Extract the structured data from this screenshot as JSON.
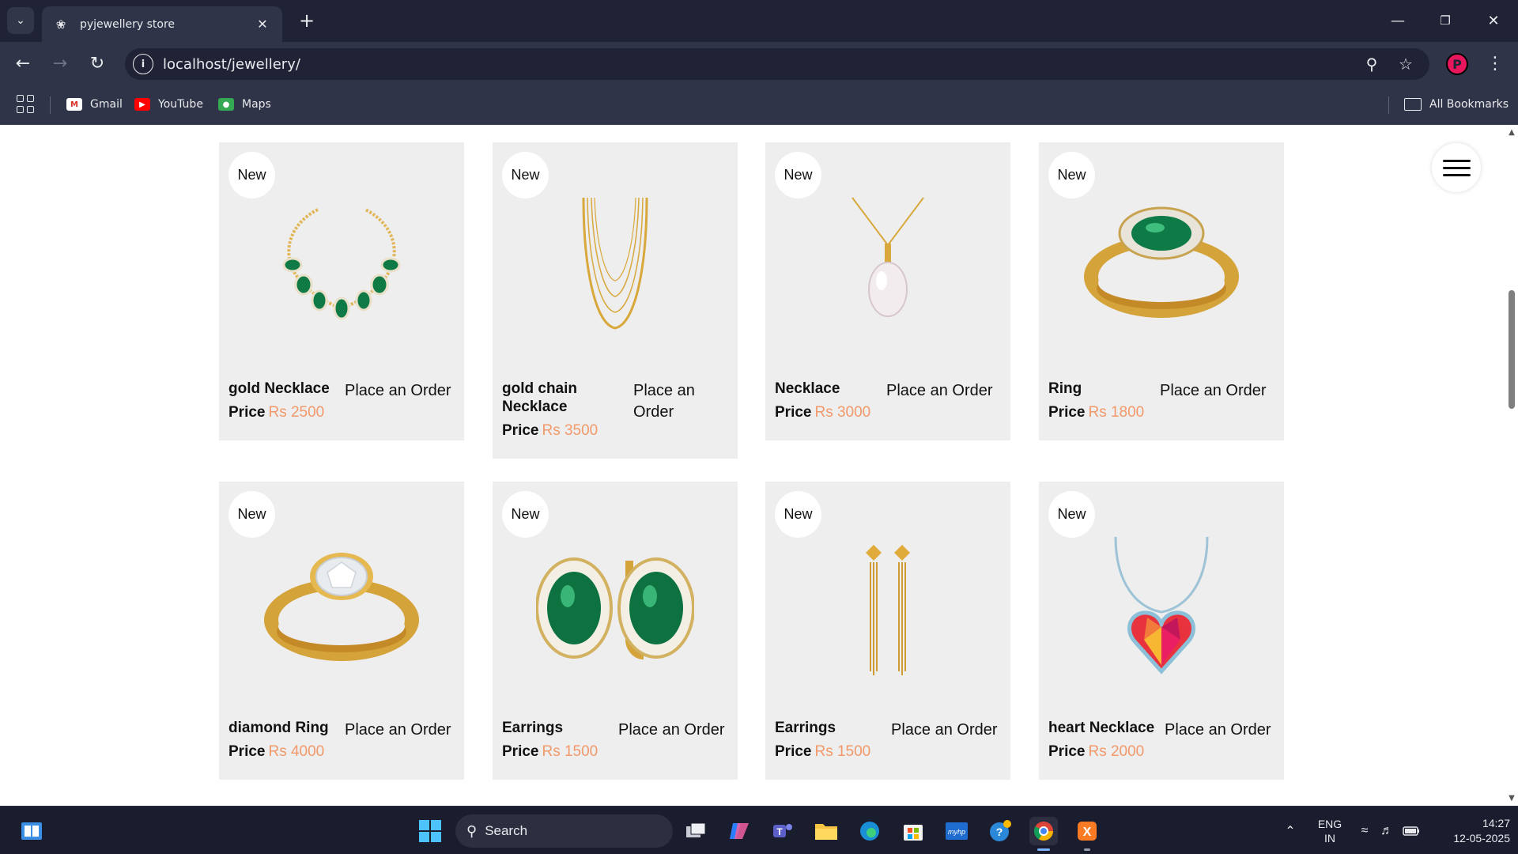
{
  "browser": {
    "tab_title": "pyjewellery store",
    "url": "localhost/jewellery/",
    "profile_initial": "P",
    "bookmarks": [
      {
        "label": "Gmail",
        "icon": "gmail-icon"
      },
      {
        "label": "YouTube",
        "icon": "youtube-icon"
      },
      {
        "label": "Maps",
        "icon": "maps-icon"
      }
    ],
    "all_bookmarks_label": "All Bookmarks"
  },
  "products": [
    {
      "badge": "New",
      "name": "gold Necklace",
      "order_label": "Place an Order",
      "price_label": "Price",
      "price": "Rs 2500",
      "image": "emerald-necklace"
    },
    {
      "badge": "New",
      "name": "gold chain Necklace",
      "order_label": "Place an Order",
      "price_label": "Price",
      "price": "Rs 3500",
      "image": "gold-chain"
    },
    {
      "badge": "New",
      "name": "Necklace",
      "order_label": "Place an Order",
      "price_label": "Price",
      "price": "Rs 3000",
      "image": "pearl-pendant"
    },
    {
      "badge": "New",
      "name": "Ring",
      "order_label": "Place an Order",
      "price_label": "Price",
      "price": "Rs 1800",
      "image": "emerald-ring"
    },
    {
      "badge": "New",
      "name": "diamond Ring",
      "order_label": "Place an Order",
      "price_label": "Price",
      "price": "Rs 4000",
      "image": "diamond-ring"
    },
    {
      "badge": "New",
      "name": "Earrings",
      "order_label": "Place an Order",
      "price_label": "Price",
      "price": "Rs 1500",
      "image": "emerald-earrings"
    },
    {
      "badge": "New",
      "name": "Earrings",
      "order_label": "Place an Order",
      "price_label": "Price",
      "price": "Rs 1500",
      "image": "drop-earrings"
    },
    {
      "badge": "New",
      "name": "heart Necklace",
      "order_label": "Place an Order",
      "price_label": "Price",
      "price": "Rs 2000",
      "image": "heart-pendant"
    }
  ],
  "colors": {
    "price": "#f1996a",
    "card_bg": "#eeeeee",
    "chrome_dark": "#1f2335",
    "chrome": "#2f3448"
  },
  "taskbar": {
    "search_label": "Search",
    "language": "ENG",
    "region": "IN",
    "time": "14:27",
    "date": "12-05-2025"
  }
}
